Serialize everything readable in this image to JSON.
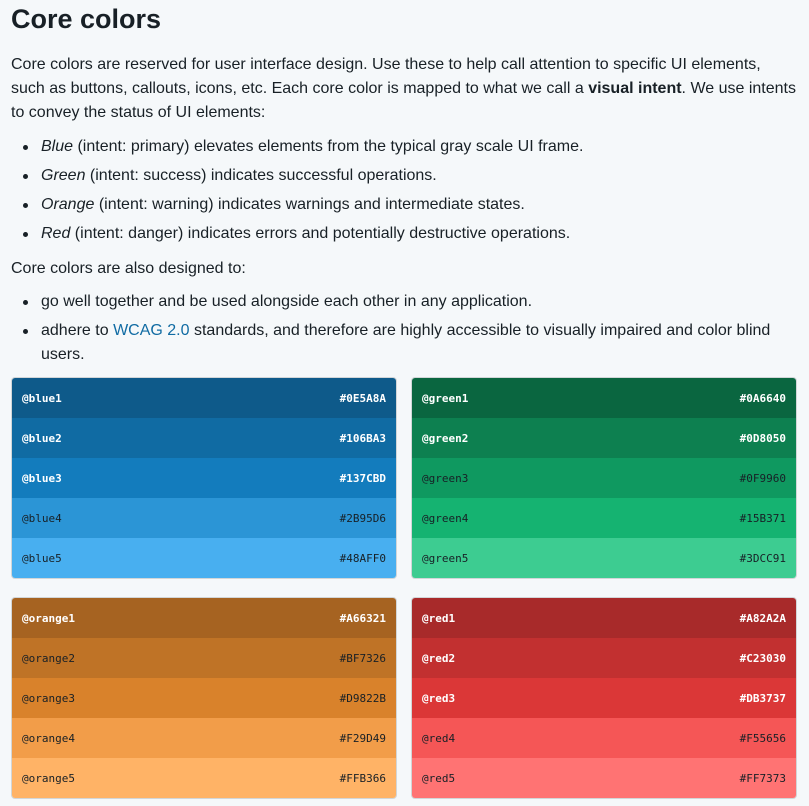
{
  "title": "Core colors",
  "intro": {
    "before_bold": "Core colors are reserved for user interface design. Use these to help call attention to specific UI elements, such as buttons, callouts, icons, etc. Each core color is mapped to what we call a ",
    "bold": "visual intent",
    "after_bold": ". We use intents to convey the status of UI elements:"
  },
  "intents": [
    {
      "name": "Blue",
      "text": " (intent: primary) elevates elements from the typical gray scale UI frame."
    },
    {
      "name": "Green",
      "text": " (intent: success) indicates successful operations."
    },
    {
      "name": "Orange",
      "text": " (intent: warning) indicates warnings and intermediate states."
    },
    {
      "name": "Red",
      "text": " (intent: danger) indicates errors and potentially destructive operations."
    }
  ],
  "designed_intro": "Core colors are also designed to:",
  "designed_items": [
    {
      "text": "go well together and be used alongside each other in any application."
    },
    {
      "before_link": "adhere to ",
      "link": "WCAG 2.0",
      "after_link": " standards, and therefore are highly accessible to visually impaired and color blind users."
    }
  ],
  "palettes": [
    {
      "id": "blue",
      "swatches": [
        {
          "name": "@blue1",
          "hex": "#0E5A8A",
          "text": "light"
        },
        {
          "name": "@blue2",
          "hex": "#106BA3",
          "text": "light"
        },
        {
          "name": "@blue3",
          "hex": "#137CBD",
          "text": "light"
        },
        {
          "name": "@blue4",
          "hex": "#2B95D6",
          "text": "dark"
        },
        {
          "name": "@blue5",
          "hex": "#48AFF0",
          "text": "dark"
        }
      ]
    },
    {
      "id": "green",
      "swatches": [
        {
          "name": "@green1",
          "hex": "#0A6640",
          "text": "light"
        },
        {
          "name": "@green2",
          "hex": "#0D8050",
          "text": "light"
        },
        {
          "name": "@green3",
          "hex": "#0F9960",
          "text": "dark"
        },
        {
          "name": "@green4",
          "hex": "#15B371",
          "text": "dark"
        },
        {
          "name": "@green5",
          "hex": "#3DCC91",
          "text": "dark"
        }
      ]
    },
    {
      "id": "orange",
      "swatches": [
        {
          "name": "@orange1",
          "hex": "#A66321",
          "text": "light"
        },
        {
          "name": "@orange2",
          "hex": "#BF7326",
          "text": "dark"
        },
        {
          "name": "@orange3",
          "hex": "#D9822B",
          "text": "dark"
        },
        {
          "name": "@orange4",
          "hex": "#F29D49",
          "text": "dark"
        },
        {
          "name": "@orange5",
          "hex": "#FFB366",
          "text": "dark"
        }
      ]
    },
    {
      "id": "red",
      "swatches": [
        {
          "name": "@red1",
          "hex": "#A82A2A",
          "text": "light"
        },
        {
          "name": "@red2",
          "hex": "#C23030",
          "text": "light"
        },
        {
          "name": "@red3",
          "hex": "#DB3737",
          "text": "light"
        },
        {
          "name": "@red4",
          "hex": "#F55656",
          "text": "dark"
        },
        {
          "name": "@red5",
          "hex": "#FF7373",
          "text": "dark"
        }
      ]
    }
  ]
}
